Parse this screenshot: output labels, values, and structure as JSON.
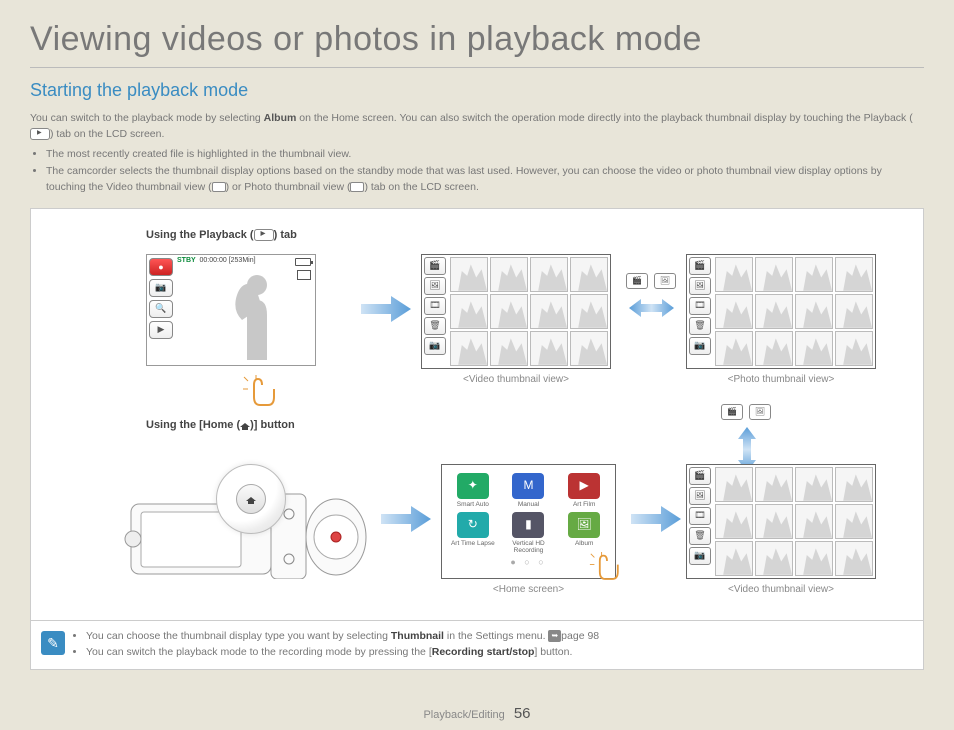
{
  "title": "Viewing videos or photos in playback mode",
  "section_title": "Starting the playback mode",
  "intro_p1a": "You can switch to the playback mode by selecting ",
  "intro_album": "Album",
  "intro_p1b": " on the Home screen. You can also switch the operation mode directly into the playback thumbnail display by touching the Playback (",
  "intro_p1c": ") tab on the LCD screen.",
  "intro_b1": "The most recently created file is highlighted in the thumbnail view.",
  "intro_b2a": "The camcorder selects the thumbnail display options based on the standby mode that was last used. However, you can choose the video or photo thumbnail view display options by touching the Video thumbnail view (",
  "intro_b2b": ") or Photo thumbnail view (",
  "intro_b2c": ") tab on the LCD screen.",
  "sub1a": "Using the Playback (",
  "sub1b": ") tab",
  "sub2a": "Using the [Home (",
  "sub2b": ")] button",
  "stby_label": "STBY",
  "stby_time": "00:00:00 [253Min]",
  "cap_video": "<Video thumbnail view>",
  "cap_photo": "<Photo thumbnail view>",
  "cap_home": "<Home screen>",
  "apps": {
    "a1": "Smart Auto",
    "a2": "Manual",
    "a3": "Art Film",
    "a4": "Art Time Lapse",
    "a5": "Vertical HD Recording",
    "a6": "Album"
  },
  "note_b1a": "You can choose the thumbnail display type you want by selecting ",
  "note_thumb": "Thumbnail",
  "note_b1b": " in the Settings menu. ",
  "note_page_ref": "page 98",
  "note_b2a": "You can switch the playback mode to the recording mode by pressing the [",
  "note_rec": "Recording start/stop",
  "note_b2b": "] button.",
  "footer_section": "Playback/Editing",
  "footer_page": "56"
}
